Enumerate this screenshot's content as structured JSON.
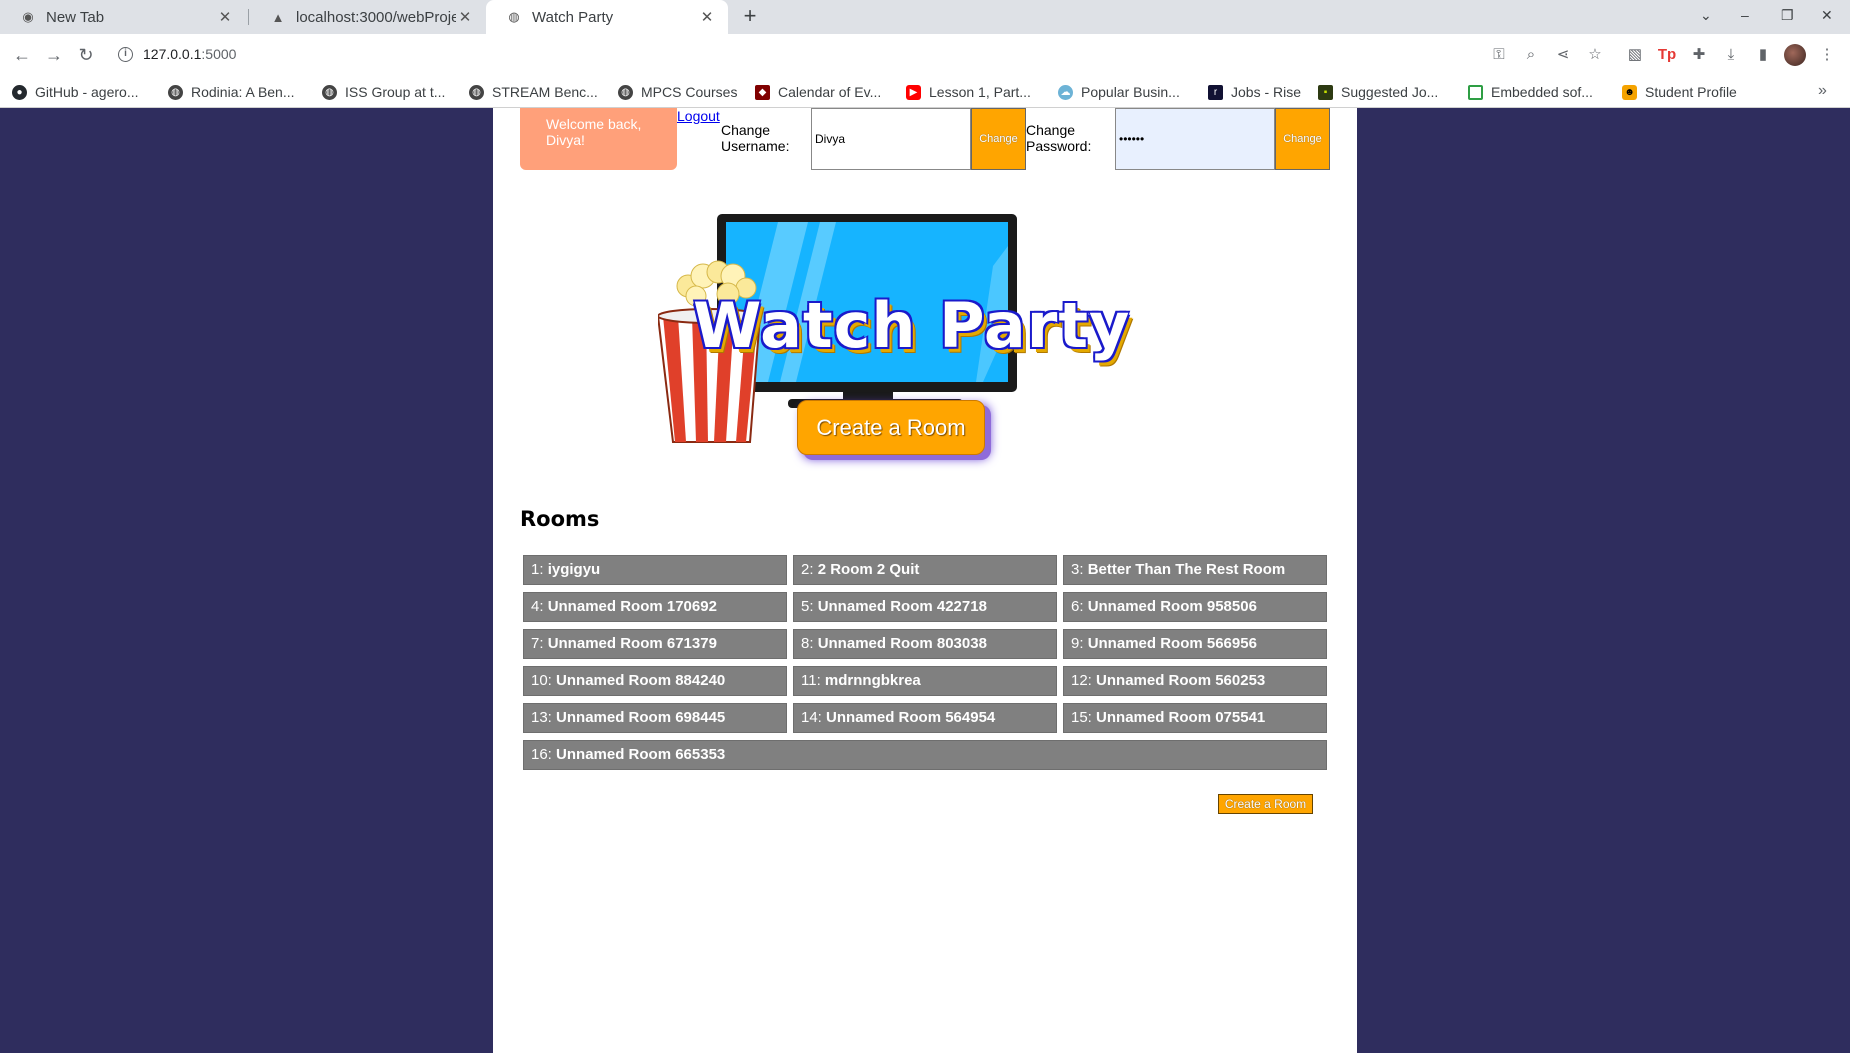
{
  "browser": {
    "tabs": [
      {
        "label": "New Tab",
        "icon": "chrome-icon"
      },
      {
        "label": "localhost:3000/webProje",
        "icon": "triangle-icon"
      },
      {
        "label": "Watch Party",
        "icon": "globe-icon"
      }
    ],
    "url_host": "127.0.0.1",
    "url_port": ":5000",
    "bookmarks": [
      "GitHub - agero...",
      "Rodinia: A Ben...",
      "ISS Group at t...",
      "STREAM Benc...",
      "MPCS Courses",
      "Calendar of Ev...",
      "Lesson 1, Part...",
      "Popular Busin...",
      "Jobs - Rise",
      "Suggested Jo...",
      "Embedded sof...",
      "Student Profile"
    ]
  },
  "header": {
    "welcome": "Welcome back, Divya!",
    "logout": "Logout",
    "change_username_label": "Change Username:",
    "username_value": "Divya",
    "change_password_label": "Change Password:",
    "password_value": "••••••",
    "change_button": "Change"
  },
  "hero": {
    "title": "Watch Party",
    "create_button": "Create a Room"
  },
  "rooms": {
    "heading": "Rooms",
    "list": [
      {
        "num": "1:",
        "name": "iygigyu"
      },
      {
        "num": "2:",
        "name": "2 Room 2 Quit"
      },
      {
        "num": "3:",
        "name": "Better Than The Rest Room"
      },
      {
        "num": "4:",
        "name": "Unnamed Room 170692"
      },
      {
        "num": "5:",
        "name": "Unnamed Room 422718"
      },
      {
        "num": "6:",
        "name": "Unnamed Room 958506"
      },
      {
        "num": "7:",
        "name": "Unnamed Room 671379"
      },
      {
        "num": "8:",
        "name": "Unnamed Room 803038"
      },
      {
        "num": "9:",
        "name": "Unnamed Room 566956"
      },
      {
        "num": "10:",
        "name": "Unnamed Room 884240"
      },
      {
        "num": "11:",
        "name": "mdrnngbkrea"
      },
      {
        "num": "12:",
        "name": "Unnamed Room 560253"
      },
      {
        "num": "13:",
        "name": "Unnamed Room 698445"
      },
      {
        "num": "14:",
        "name": "Unnamed Room 564954"
      },
      {
        "num": "15:",
        "name": "Unnamed Room 075541"
      },
      {
        "num": "16:",
        "name": "Unnamed Room 665353"
      }
    ],
    "create_button": "Create a Room"
  },
  "colors": {
    "background": "#2f2d5e",
    "accent": "#ffa500",
    "welcome": "#ffa07a",
    "room_tile": "#808080"
  }
}
